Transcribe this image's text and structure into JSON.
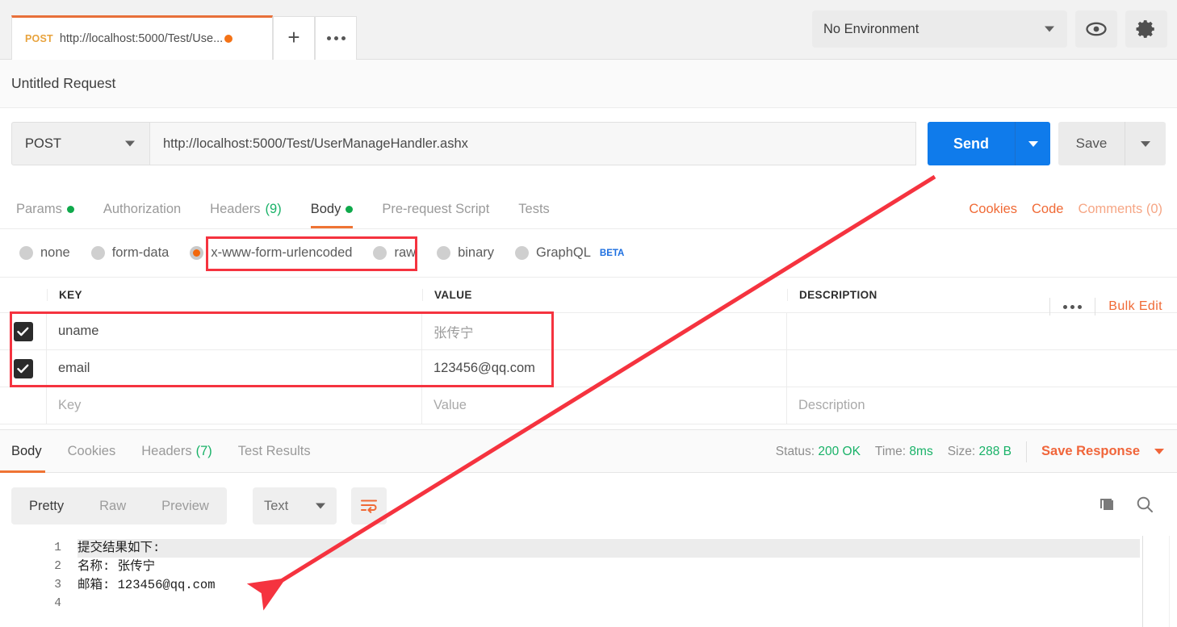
{
  "window": {
    "tab": {
      "method": "POST",
      "url_short": "http://localhost:5000/Test/Use...",
      "unsaved_icon": "unsaved-dot"
    },
    "new_tab_label": "+",
    "more_tabs_icon": "ellipsis-icon",
    "environment": {
      "selected": "No Environment",
      "eye_icon": "eye-icon",
      "settings_icon": "gear-icon"
    }
  },
  "request": {
    "title": "Untitled Request",
    "method": "POST",
    "url": "http://localhost:5000/Test/UserManageHandler.ashx",
    "send_label": "Send",
    "save_label": "Save",
    "tabs": [
      {
        "label": "Params",
        "badge": "dot",
        "active": false
      },
      {
        "label": "Authorization",
        "badge": "",
        "active": false
      },
      {
        "label": "Headers",
        "badge": "(9)",
        "active": false
      },
      {
        "label": "Body",
        "badge": "dot",
        "active": true
      },
      {
        "label": "Pre-request Script",
        "badge": "",
        "active": false
      },
      {
        "label": "Tests",
        "badge": "",
        "active": false
      }
    ],
    "tab_links": {
      "cookies": "Cookies",
      "code": "Code",
      "comments": "Comments (0)"
    },
    "body_types": [
      {
        "label": "none",
        "selected": false
      },
      {
        "label": "form-data",
        "selected": false
      },
      {
        "label": "x-www-form-urlencoded",
        "selected": true
      },
      {
        "label": "raw",
        "selected": false
      },
      {
        "label": "binary",
        "selected": false
      },
      {
        "label": "GraphQL",
        "selected": false,
        "badge": "BETA"
      }
    ],
    "table": {
      "headers": {
        "key": "KEY",
        "value": "VALUE",
        "description": "DESCRIPTION"
      },
      "more_icon": "ellipsis-icon",
      "bulk_edit": "Bulk Edit",
      "rows": [
        {
          "checked": true,
          "key": "uname",
          "value": "张传宁",
          "description": "",
          "value_muted": true
        },
        {
          "checked": true,
          "key": "email",
          "value": "123456@qq.com",
          "description": "",
          "value_muted": false
        }
      ],
      "placeholder_row": {
        "key": "Key",
        "value": "Value",
        "description": "Description"
      }
    }
  },
  "response": {
    "tabs": [
      {
        "label": "Body",
        "badge": "",
        "active": true
      },
      {
        "label": "Cookies",
        "badge": "",
        "active": false
      },
      {
        "label": "Headers",
        "badge": "(7)",
        "active": false
      },
      {
        "label": "Test Results",
        "badge": "",
        "active": false
      }
    ],
    "status": {
      "status_label": "Status:",
      "status_value": "200 OK",
      "time_label": "Time:",
      "time_value": "8ms",
      "size_label": "Size:",
      "size_value": "288 B",
      "save_response": "Save Response"
    },
    "toolbar": {
      "views": [
        {
          "label": "Pretty",
          "active": true
        },
        {
          "label": "Raw",
          "active": false
        },
        {
          "label": "Preview",
          "active": false
        }
      ],
      "format": "Text",
      "wrap_icon": "word-wrap-icon",
      "copy_icon": "copy-icon",
      "search_icon": "search-icon"
    },
    "body_lines": [
      {
        "n": "1",
        "text": "提交结果如下:",
        "highlighted": true
      },
      {
        "n": "2",
        "text": "名称: 张传宁",
        "highlighted": false
      },
      {
        "n": "3",
        "text": "邮箱: 123456@qq.com",
        "highlighted": false
      },
      {
        "n": "4",
        "text": "",
        "highlighted": false
      }
    ]
  },
  "annotations": {
    "highlight_color": "#f5333f",
    "boxes": [
      {
        "name": "x-www-form-urlencoded-highlight"
      },
      {
        "name": "kv-rows-highlight"
      },
      {
        "name": "value-column-highlight"
      }
    ],
    "arrow": {
      "name": "pointer-arrow",
      "from": "send-button-area",
      "to": "response-body-line-3"
    }
  },
  "colors": {
    "accent_orange": "#ef7434",
    "send_blue": "#0f7beb",
    "success_green": "#19b268",
    "annotation_red": "#f5333f"
  }
}
